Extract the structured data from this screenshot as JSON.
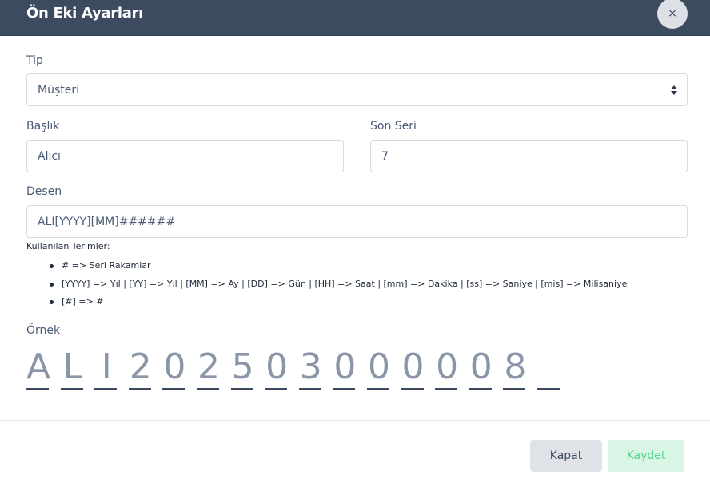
{
  "modal": {
    "title": "Ön Eki Ayarları",
    "close_icon": "×"
  },
  "form": {
    "type_label": "Tip",
    "type_value": "Müşteri",
    "title_label": "Başlık",
    "title_value": "Alıcı",
    "last_serial_label": "Son Seri",
    "last_serial_value": "7",
    "pattern_label": "Desen",
    "pattern_value": "ALI[YYYY][MM]######"
  },
  "terms": {
    "title": "Kullanılan Terimler:",
    "items": [
      "# => Seri Rakamlar",
      "[YYYY] => Yıl | [YY] => Yıl | [MM] => Ay | [DD] => Gün | [HH] => Saat | [mm] => Dakika | [ss] => Saniye | [mis] => Milisaniye",
      "[#] => #"
    ]
  },
  "example": {
    "label": "Örnek",
    "chars": [
      "A",
      "L",
      "I",
      "2",
      "0",
      "2",
      "5",
      "0",
      "3",
      "0",
      "0",
      "0",
      "0",
      "0",
      "8",
      ""
    ]
  },
  "footer": {
    "close_label": "Kapat",
    "save_label": "Kaydet"
  },
  "colors": {
    "header_bg": "#3d4b60",
    "save_bg": "#d8f5e6",
    "save_text": "#54d38f"
  }
}
